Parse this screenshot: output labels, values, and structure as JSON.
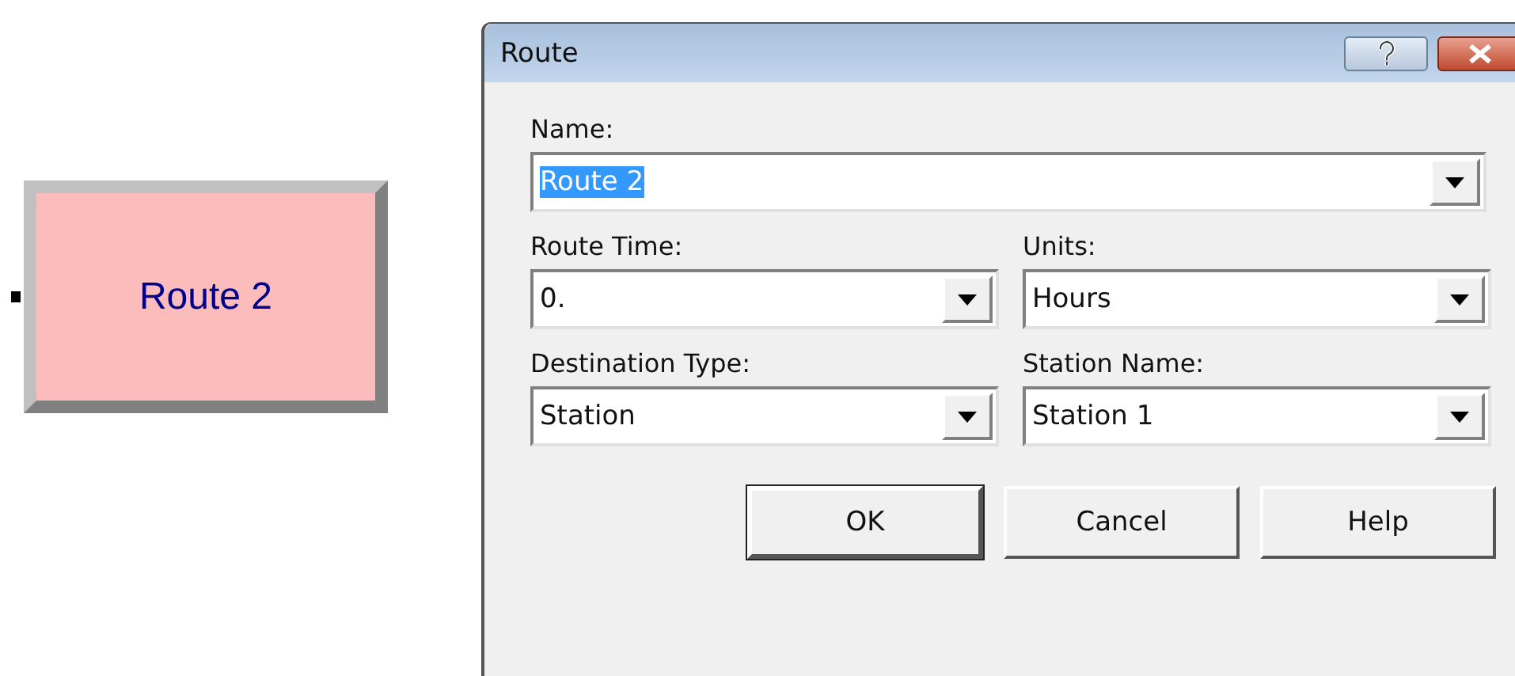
{
  "module": {
    "label": "Route 2"
  },
  "dialog": {
    "title": "Route",
    "fields": [
      {
        "label": "Name:",
        "value": "Route 2",
        "text_selected": true
      },
      {
        "label": "Route Time:",
        "value": "0.",
        "text_selected": false
      },
      {
        "label": "Units:",
        "value": "Hours",
        "text_selected": false
      },
      {
        "label": "Destination Type:",
        "value": "Station",
        "text_selected": false
      },
      {
        "label": "Station Name:",
        "value": "Station 1",
        "text_selected": false
      }
    ],
    "buttons": [
      {
        "label": "OK",
        "default": true
      },
      {
        "label": "Cancel",
        "default": false
      },
      {
        "label": "Help",
        "default": false
      }
    ]
  }
}
